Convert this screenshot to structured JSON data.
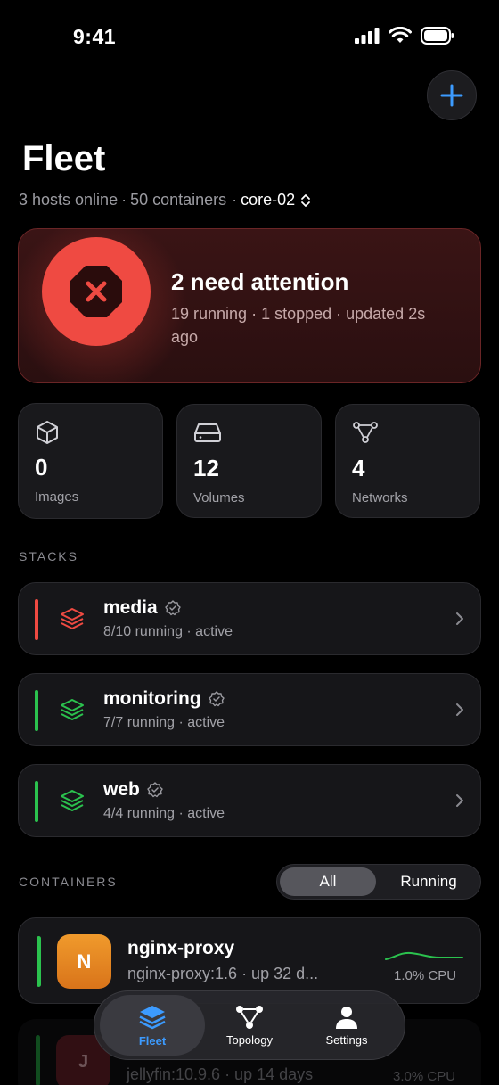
{
  "status_bar": {
    "time": "9:41"
  },
  "header": {
    "title": "Fleet",
    "hosts_online": "3 hosts online",
    "containers_count": "50 containers",
    "separator": "·",
    "host_selector": "core-02"
  },
  "alert": {
    "title": "2 need attention",
    "subtitle": "19 running · 1 stopped · updated 2s ago"
  },
  "stats": [
    {
      "value": "0",
      "label": "Images",
      "icon": "box-icon"
    },
    {
      "value": "12",
      "label": "Volumes",
      "icon": "drive-icon"
    },
    {
      "value": "4",
      "label": "Networks",
      "icon": "network-icon"
    }
  ],
  "stacks_section": {
    "label": "STACKS"
  },
  "stacks": [
    {
      "name": "media",
      "meta": "8/10 running · active",
      "status_color": "#ef4a42"
    },
    {
      "name": "monitoring",
      "meta": "7/7 running · active",
      "status_color": "#2bc24e"
    },
    {
      "name": "web",
      "meta": "4/4 running · active",
      "status_color": "#2bc24e"
    }
  ],
  "containers_section": {
    "label": "CONTAINERS",
    "filter": {
      "all": "All",
      "running": "Running",
      "selected": "All"
    }
  },
  "containers": [
    {
      "initial": "N",
      "name": "nginx-proxy",
      "meta": "nginx-proxy:1.6 · up 32 d...",
      "cpu": "1.0% CPU"
    },
    {
      "initial": "J",
      "name": "jellyfin",
      "meta": "jellyfin:10.9.6 · up 14 days",
      "cpu": "3.0% CPU"
    }
  ],
  "tabbar": {
    "fleet": "Fleet",
    "topology": "Topology",
    "settings": "Settings",
    "active": "Fleet"
  },
  "colors": {
    "accent": "#3c9bff",
    "danger": "#ef4a42",
    "success": "#2bc24e"
  }
}
